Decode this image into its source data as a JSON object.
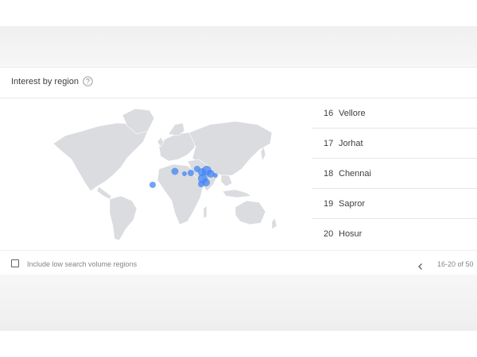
{
  "widget": {
    "title": "Interest by region",
    "help_icon": "help-circle-icon"
  },
  "regions": [
    {
      "rank": "16",
      "name": "Vellore"
    },
    {
      "rank": "17",
      "name": "Jorhat"
    },
    {
      "rank": "18",
      "name": "Chennai"
    },
    {
      "rank": "19",
      "name": "Sapror"
    },
    {
      "rank": "20",
      "name": "Hosur"
    }
  ],
  "footer": {
    "checkbox_label": "Include low search volume regions",
    "checkbox_checked": false,
    "prev_icon": "chevron-left-icon",
    "pagination": "16-20 of 50"
  },
  "colors": {
    "land": "#dadce0",
    "bubble": "#4285f4",
    "text": "#3c4043",
    "muted": "#80868b"
  }
}
